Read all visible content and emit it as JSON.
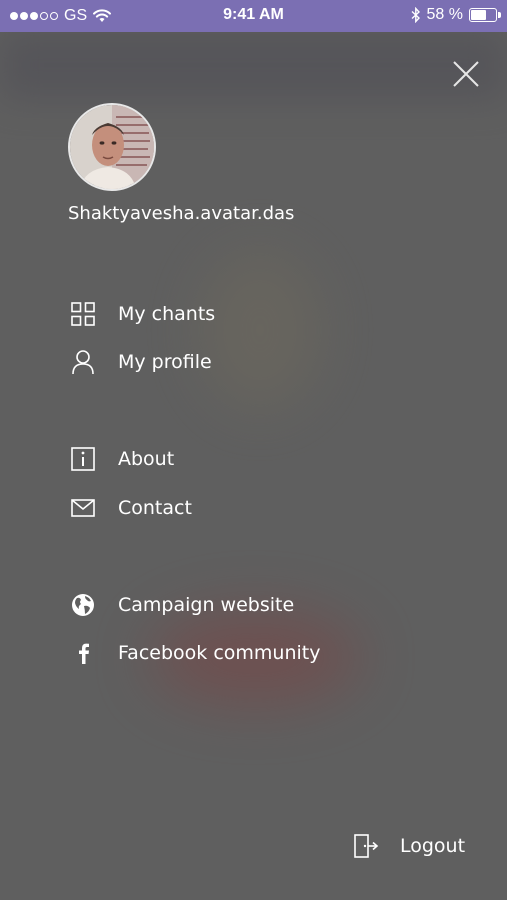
{
  "status_bar": {
    "carrier": "GS",
    "time": "9:41 AM",
    "battery": "58 %",
    "battery_level": 0.58,
    "signal_dots_filled": 3,
    "signal_dots_total": 5
  },
  "profile": {
    "username": "Shaktyavesha.avatar.das"
  },
  "menu": {
    "my_chants": "My chants",
    "my_profile": "My profile",
    "about": "About",
    "contact": "Contact",
    "campaign_website": "Campaign website",
    "facebook_community": "Facebook community",
    "logout": "Logout"
  },
  "icons": {
    "close": "close-icon",
    "my_chants": "grid-icon",
    "my_profile": "user-icon",
    "about": "info-icon",
    "contact": "mail-icon",
    "campaign_website": "globe-icon",
    "facebook_community": "facebook-icon",
    "logout": "logout-icon"
  },
  "colors": {
    "status_bar": "#7b6fb3",
    "overlay": "#5f5f5f",
    "text": "#ffffff"
  }
}
